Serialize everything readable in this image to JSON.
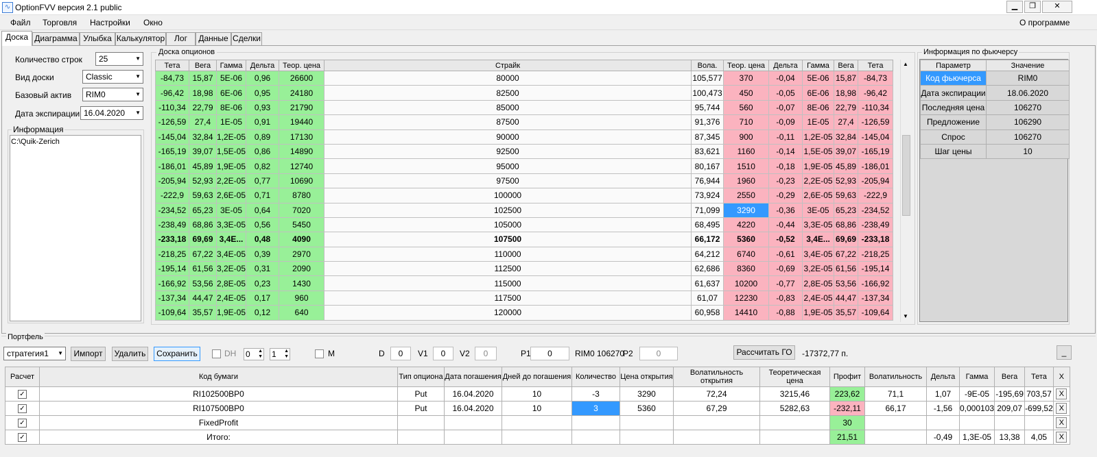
{
  "app": {
    "title": "OptionFVV версия 2.1 public"
  },
  "menu": [
    "Файл",
    "Торговля",
    "Настройки",
    "Окно"
  ],
  "about": "О программе",
  "tabs": [
    "Доска",
    "Диаграмма",
    "Улыбка",
    "Калькулятор",
    "Лог",
    "Данные",
    "Сделки"
  ],
  "left": {
    "rows_label": "Количество строк",
    "rows_value": "25",
    "view_label": "Вид доски",
    "view_value": "Classic",
    "asset_label": "Базовый актив",
    "asset_value": "RIM0",
    "exp_label": "Дата экспирации",
    "exp_value": "16.04.2020",
    "info_title": "Информация",
    "info_text": "C:\\Quik-Zerich"
  },
  "board": {
    "title": "Доска опционов",
    "headers": [
      "Тета",
      "Вега",
      "Гамма",
      "Дельта",
      "Теор. цена",
      "Страйк",
      "Вола.",
      "Теор. цена",
      "Дельта",
      "Гамма",
      "Вега",
      "Тета"
    ],
    "rows": [
      [
        "-84,73",
        "15,87",
        "5E-06",
        "0,96",
        "26600",
        "80000",
        "105,577",
        "370",
        "-0,04",
        "5E-06",
        "15,87",
        "-84,73"
      ],
      [
        "-96,42",
        "18,98",
        "6E-06",
        "0,95",
        "24180",
        "82500",
        "100,473",
        "450",
        "-0,05",
        "6E-06",
        "18,98",
        "-96,42"
      ],
      [
        "-110,34",
        "22,79",
        "8E-06",
        "0,93",
        "21790",
        "85000",
        "95,744",
        "560",
        "-0,07",
        "8E-06",
        "22,79",
        "-110,34"
      ],
      [
        "-126,59",
        "27,4",
        "1E-05",
        "0,91",
        "19440",
        "87500",
        "91,376",
        "710",
        "-0,09",
        "1E-05",
        "27,4",
        "-126,59"
      ],
      [
        "-145,04",
        "32,84",
        "1,2E-05",
        "0,89",
        "17130",
        "90000",
        "87,345",
        "900",
        "-0,11",
        "1,2E-05",
        "32,84",
        "-145,04"
      ],
      [
        "-165,19",
        "39,07",
        "1,5E-05",
        "0,86",
        "14890",
        "92500",
        "83,621",
        "1160",
        "-0,14",
        "1,5E-05",
        "39,07",
        "-165,19"
      ],
      [
        "-186,01",
        "45,89",
        "1,9E-05",
        "0,82",
        "12740",
        "95000",
        "80,167",
        "1510",
        "-0,18",
        "1,9E-05",
        "45,89",
        "-186,01"
      ],
      [
        "-205,94",
        "52,93",
        "2,2E-05",
        "0,77",
        "10690",
        "97500",
        "76,944",
        "1960",
        "-0,23",
        "2,2E-05",
        "52,93",
        "-205,94"
      ],
      [
        "-222,9",
        "59,63",
        "2,6E-05",
        "0,71",
        "8780",
        "100000",
        "73,924",
        "2550",
        "-0,29",
        "2,6E-05",
        "59,63",
        "-222,9"
      ],
      [
        "-234,52",
        "65,23",
        "3E-05",
        "0,64",
        "7020",
        "102500",
        "71,099",
        "3290",
        "-0,36",
        "3E-05",
        "65,23",
        "-234,52"
      ],
      [
        "-238,49",
        "68,86",
        "3,3E-05",
        "0,56",
        "5450",
        "105000",
        "68,495",
        "4220",
        "-0,44",
        "3,3E-05",
        "68,86",
        "-238,49"
      ],
      [
        "-233,18",
        "69,69",
        "3,4E...",
        "0,48",
        "4090",
        "107500",
        "66,172",
        "5360",
        "-0,52",
        "3,4E...",
        "69,69",
        "-233,18"
      ],
      [
        "-218,25",
        "67,22",
        "3,4E-05",
        "0,39",
        "2970",
        "110000",
        "64,212",
        "6740",
        "-0,61",
        "3,4E-05",
        "67,22",
        "-218,25"
      ],
      [
        "-195,14",
        "61,56",
        "3,2E-05",
        "0,31",
        "2090",
        "112500",
        "62,686",
        "8360",
        "-0,69",
        "3,2E-05",
        "61,56",
        "-195,14"
      ],
      [
        "-166,92",
        "53,56",
        "2,8E-05",
        "0,23",
        "1430",
        "115000",
        "61,637",
        "10200",
        "-0,77",
        "2,8E-05",
        "53,56",
        "-166,92"
      ],
      [
        "-137,34",
        "44,47",
        "2,4E-05",
        "0,17",
        "960",
        "117500",
        "61,07",
        "12230",
        "-0,83",
        "2,4E-05",
        "44,47",
        "-137,34"
      ],
      [
        "-109,64",
        "35,57",
        "1,9E-05",
        "0,12",
        "640",
        "120000",
        "60,958",
        "14410",
        "-0,88",
        "1,9E-05",
        "35,57",
        "-109,64"
      ]
    ]
  },
  "futures": {
    "title": "Информация по фьючерсу",
    "headers": [
      "Параметр",
      "Значение"
    ],
    "rows": [
      [
        "Код фьючерса",
        "RIM0"
      ],
      [
        "Дата экспирации",
        "18.06.2020"
      ],
      [
        "Последняя цена",
        "106270"
      ],
      [
        "Предложение",
        "106290"
      ],
      [
        "Спрос",
        "106270"
      ],
      [
        "Шаг цены",
        "10"
      ]
    ]
  },
  "portfolio": {
    "title": "Портфель",
    "strategy": "стратегия1",
    "btn_import": "Импорт",
    "btn_delete": "Удалить",
    "btn_save": "Сохранить",
    "dh_label": "DH",
    "dh_val1": "0",
    "dh_val2": "1",
    "m_label": "M",
    "d_label": "D",
    "d_val": "0",
    "v1_label": "V1",
    "v1_val": "0",
    "v2_label": "V2",
    "v2_val": "0",
    "p1_label": "P1",
    "p1_val": "0",
    "rim_text": "RIM0 106270",
    "p2_label": "P2",
    "p2_val": "0",
    "btn_go": "Рассчитать ГО",
    "go_value": "-17372,77 п.",
    "btn_min": "_",
    "headers": [
      "Расчет",
      "Код бумаги",
      "Тип опциона",
      "Дата погашения",
      "Дней до погашения",
      "Количество",
      "Цена открытия",
      "Волатильность открытия",
      "Теоретическая цена",
      "Профит",
      "Волатильность",
      "Дельта",
      "Гамма",
      "Вега",
      "Тета",
      "X"
    ],
    "rows": [
      [
        "✓",
        "RI102500BP0",
        "Put",
        "16.04.2020",
        "10",
        "-3",
        "3290",
        "72,24",
        "3215,46",
        "223,62",
        "71,1",
        "1,07",
        "-9E-05",
        "-195,69",
        "703,57",
        "X"
      ],
      [
        "✓",
        "RI107500BP0",
        "Put",
        "16.04.2020",
        "10",
        "3",
        "5360",
        "67,29",
        "5282,63",
        "-232,11",
        "66,17",
        "-1,56",
        "0,000103",
        "209,07",
        "-699,52",
        "X"
      ],
      [
        "✓",
        "FixedProfit",
        "",
        "",
        "",
        "",
        "",
        "",
        "",
        "30",
        "",
        "",
        "",
        "",
        "",
        "X"
      ],
      [
        "✓",
        "Итого:",
        "",
        "",
        "",
        "",
        "",
        "",
        "",
        "21,51",
        "",
        "-0,49",
        "1,3E-05",
        "13,38",
        "4,05",
        "X"
      ]
    ]
  }
}
